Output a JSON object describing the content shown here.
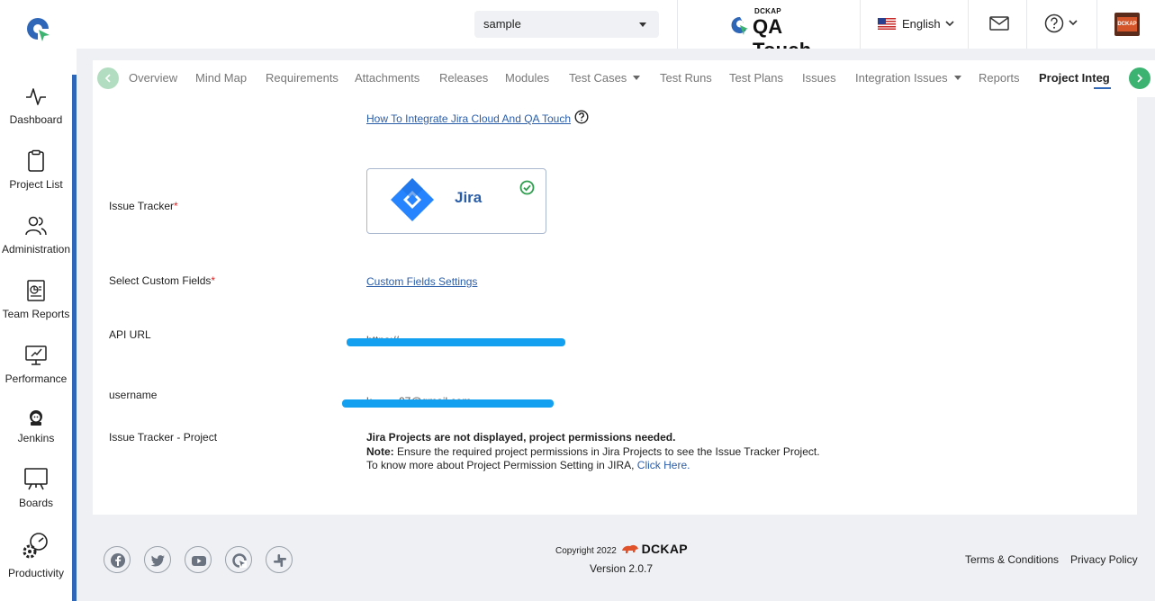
{
  "header": {
    "project_select": "sample",
    "logo_small": "DCKAP",
    "logo_main": "QA Touch",
    "language": "English",
    "avatar_text": "DCKAP"
  },
  "sidebar": {
    "items": [
      {
        "label": "Dashboard",
        "icon": "activity-icon"
      },
      {
        "label": "Project List",
        "icon": "clipboard-icon"
      },
      {
        "label": "Administration",
        "icon": "users-icon"
      },
      {
        "label": "Team Reports",
        "icon": "report-icon"
      },
      {
        "label": "Performance",
        "icon": "performance-icon"
      },
      {
        "label": "Jenkins",
        "icon": "jenkins-icon"
      },
      {
        "label": "Boards",
        "icon": "board-icon"
      },
      {
        "label": "Productivity",
        "icon": "productivity-icon"
      }
    ]
  },
  "tabs": {
    "items": [
      {
        "label": "Overview"
      },
      {
        "label": "Mind Map"
      },
      {
        "label": "Requirements"
      },
      {
        "label": "Attachments"
      },
      {
        "label": "Releases"
      },
      {
        "label": "Modules"
      },
      {
        "label": "Test Cases"
      },
      {
        "label": "Test Runs"
      },
      {
        "label": "Test Plans"
      },
      {
        "label": "Issues"
      },
      {
        "label": "Integration Issues"
      },
      {
        "label": "Reports"
      },
      {
        "label": "Project Integra"
      }
    ],
    "active": "Project Integra"
  },
  "form": {
    "how_to_link": "How To Integrate Jira Cloud And QA Touch",
    "issue_tracker_label": "Issue Tracker",
    "tracker_name": "Jira",
    "custom_fields_label": "Select Custom Fields",
    "custom_fields_link": "Custom Fields Settings",
    "api_url_label": "API URL",
    "api_url_value": "https://...........................",
    "username_label": "username",
    "username_value": "k.........07@gmail.com",
    "project_label": "Issue Tracker - Project",
    "required_mark": "*"
  },
  "notice": {
    "headline": "Jira Projects are not displayed, project permissions needed.",
    "note_label": "Note:",
    "note_text": " Ensure the required project permissions in Jira Projects to see the Issue Tracker Project.",
    "more_text": "To know more about Project Permission Setting in JIRA, ",
    "click_here": "Click Here."
  },
  "footer": {
    "copyright": "Copyright 2022",
    "brand": "DCKAP",
    "version": "Version 2.0.7",
    "terms": "Terms & Conditions",
    "privacy": "Privacy Policy"
  },
  "colors": {
    "accent": "#2e66b8",
    "green": "#3cb371",
    "mask": "#14a0f0",
    "link": "#2a5da8"
  }
}
